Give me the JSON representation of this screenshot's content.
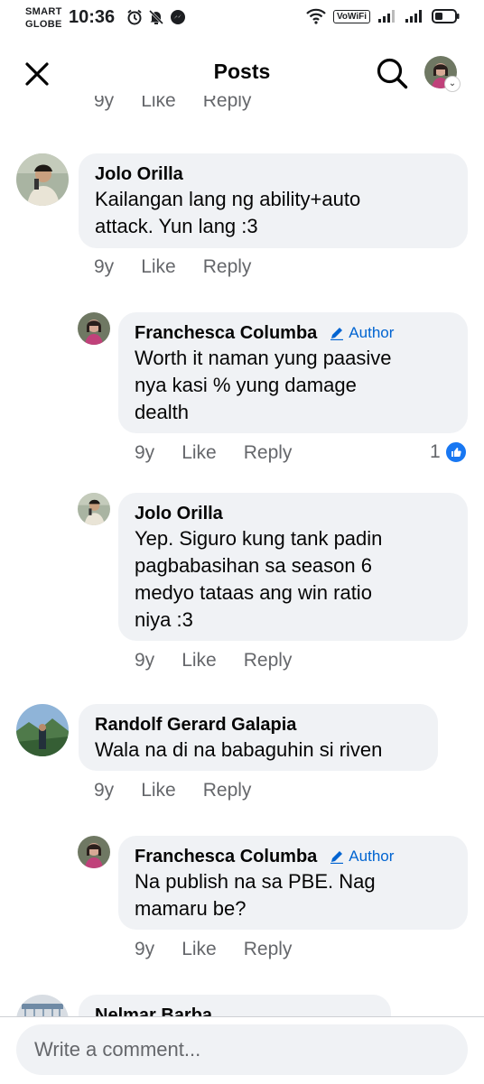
{
  "status_bar": {
    "carrier_top": "SMART",
    "carrier_bottom": "GLOBE",
    "time": "10:36",
    "vowifi": "VoWiFi"
  },
  "header": {
    "title": "Posts"
  },
  "partial_top_actions": {
    "age": "9y",
    "like": "Like",
    "reply": "Reply"
  },
  "comments": [
    {
      "author": "Jolo Orilla",
      "lines": [
        "Kailangan lang ng ability+auto",
        "attack. Yun lang :3"
      ],
      "age": "9y",
      "like": "Like",
      "reply": "Reply"
    },
    {
      "author": "Franchesca Columba",
      "badge": "Author",
      "lines": [
        "Worth it naman yung paasive",
        "nya kasi % yung damage",
        "dealth"
      ],
      "age": "9y",
      "like": "Like",
      "reply": "Reply",
      "reaction_count": "1"
    },
    {
      "author": "Jolo Orilla",
      "lines": [
        "Yep. Siguro kung tank padin",
        "pagbabasihan sa season 6",
        "medyo tataas ang win  ratio",
        "niya :3"
      ],
      "age": "9y",
      "like": "Like",
      "reply": "Reply"
    },
    {
      "author": "Randolf Gerard Galapia",
      "lines": [
        "Wala na di na babaguhin si riven"
      ],
      "age": "9y",
      "like": "Like",
      "reply": "Reply"
    },
    {
      "author": "Franchesca Columba",
      "badge": "Author",
      "lines": [
        "Na publish na sa PBE. Nag",
        "mamaru be?"
      ],
      "age": "9y",
      "like": "Like",
      "reply": "Reply"
    },
    {
      "author": "Nelmar Barba"
    }
  ],
  "comment_box": {
    "placeholder": "Write a comment..."
  }
}
